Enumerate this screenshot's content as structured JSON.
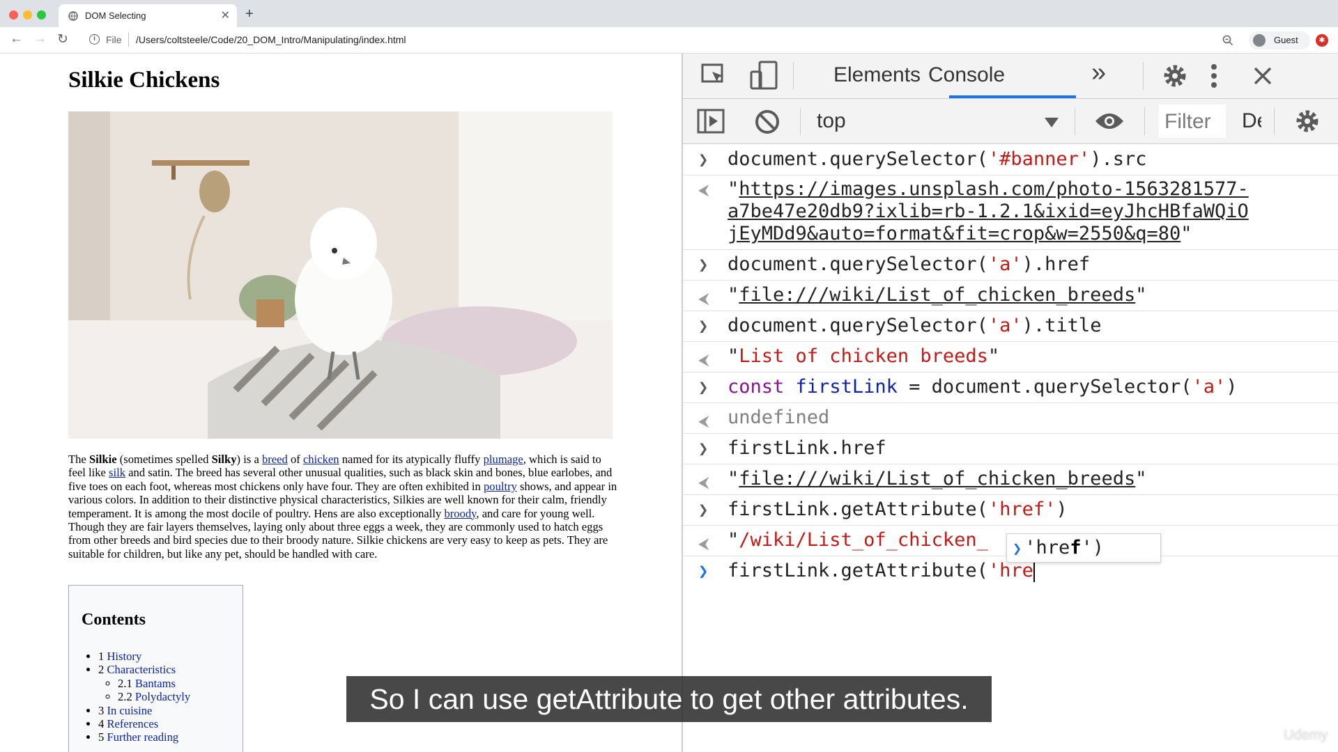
{
  "window": {
    "tab_title": "DOM Selecting",
    "tab_close": "✕",
    "new_tab": "+",
    "file_label": "File",
    "url": "/Users/coltsteele/Code/20_DOM_Intro/Manipulating/index.html",
    "profile_label": "Guest",
    "traffic_colors": [
      "#fe5f57",
      "#febc2e",
      "#28c840"
    ]
  },
  "webpage": {
    "title": "Silkie Chickens",
    "article": {
      "t1": "The ",
      "b1": "Silkie",
      "t2": " (sometimes spelled ",
      "b2": "Silky",
      "t3": ") is a ",
      "l1": "breed",
      "t4": " of ",
      "l2": "chicken",
      "t5": " named for its atypically fluffy ",
      "l3": "plumage",
      "t6": ", which is said to feel like ",
      "l4": "silk",
      "t7": " and satin. The breed has several other unusual qualities, such as black skin and bones, blue earlobes, and five toes on each foot, whereas most chickens only have four. They are often exhibited in ",
      "l5": "poultry",
      "t8": " shows, and appear in various colors. In addition to their distinctive physical characteristics, Silkies are well known for their calm, friendly temperament. It is among the most docile of poultry. Hens are also exceptionally ",
      "l6": "broody",
      "t9": ", and care for young well. Though they are fair layers themselves, laying only about three eggs a week, they are commonly used to hatch eggs from other breeds and bird species due to their broody nature. Silkie chickens are very easy to keep as pets. They are suitable for children, but like any pet, should be handled with care."
    },
    "toc": {
      "heading": "Contents",
      "items": [
        {
          "num": "1",
          "label": "History"
        },
        {
          "num": "2",
          "label": "Characteristics"
        },
        {
          "num": "2.1",
          "label": "Bantams"
        },
        {
          "num": "2.2",
          "label": "Polydactyly"
        },
        {
          "num": "3",
          "label": "In cuisine"
        },
        {
          "num": "4",
          "label": "References"
        },
        {
          "num": "5",
          "label": "Further reading"
        }
      ]
    }
  },
  "devtools": {
    "tabs": {
      "elements": "Elements",
      "console": "Console",
      "more": "»"
    },
    "context": "top",
    "filter_placeholder": "Filter",
    "levels_label": "Default levels",
    "accent_color": "#1a73e8",
    "string_color": "#c41a16",
    "console": {
      "l1_in_a": "document.querySelector(",
      "l1_in_s": "'#banner'",
      "l1_in_b": ").src",
      "l1_out_url_1": "https://images.unsplash.com/photo-1563281577-",
      "l1_out_url_2": "a7be47e20db9?ixlib=rb-1.2.1&ixid=eyJhcHBfaWQiO",
      "l1_out_url_3": "jEyMDd9&auto=format&fit=crop&w=2550&q=80",
      "l2_in_a": "document.querySelector(",
      "l2_in_s": "'a'",
      "l2_in_b": ").href",
      "l2_out": "file:///wiki/List_of_chicken_breeds",
      "l3_in_a": "document.querySelector(",
      "l3_in_s": "'a'",
      "l3_in_b": ").title",
      "l3_out": "List of chicken breeds",
      "l4_kw": "const",
      "l4_var": "firstLink",
      "l4_eq": " = document.querySelector(",
      "l4_s": "'a'",
      "l4_end": ")",
      "l4_out": "undefined",
      "l5_in": "firstLink.href",
      "l5_out": "file:///wiki/List_of_chicken_breeds",
      "l6_in_a": "firstLink.getAttribute(",
      "l6_in_s": "'href'",
      "l6_in_b": ")",
      "l6_out": "/wiki/List_of_chicken_",
      "current_a": "firstLink.getAttribute(",
      "current_s": "'hre"
    },
    "autocomplete": {
      "str": "'hre",
      "bold": "f",
      "rest": "')"
    }
  },
  "subtitle": "So I can use getAttribute to get other attributes.",
  "watermark": "Udemy"
}
